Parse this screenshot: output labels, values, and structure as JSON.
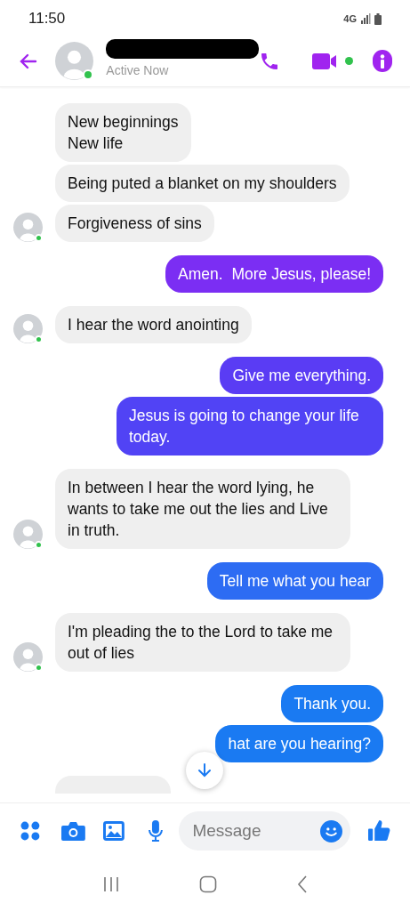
{
  "status_bar": {
    "time": "11:50",
    "network": "4G"
  },
  "header": {
    "status": "Active Now",
    "online": true
  },
  "messages": [
    {
      "kind": "incoming",
      "text": "New beginnings\nNew life"
    },
    {
      "kind": "incoming",
      "text": "Being puted a blanket on my shoulders"
    },
    {
      "kind": "incoming",
      "text": "Forgiveness of sins"
    },
    {
      "kind": "outgoing",
      "text": "Amen.  More Jesus, please!",
      "color": "#7b2ef3"
    },
    {
      "kind": "incoming",
      "text": "I hear the word anointing"
    },
    {
      "kind": "outgoing",
      "text": "Give me everything.",
      "color": "#5a3cf4"
    },
    {
      "kind": "outgoing",
      "text": "Jesus is going to change your life today.",
      "color": "#5143f5"
    },
    {
      "kind": "incoming",
      "text": "In between I hear the word lying, he wants to take me out the lies and Live in truth."
    },
    {
      "kind": "outgoing",
      "text": "Tell me what you hear",
      "color": "#2d6cf3"
    },
    {
      "kind": "incoming",
      "text": "I'm pleading the to the Lord to take me out of lies"
    },
    {
      "kind": "outgoing",
      "text": "Thank you.",
      "color": "#1a7af2"
    },
    {
      "kind": "outgoing",
      "text": "hat are you hearing?",
      "color": "#1a7af2"
    },
    {
      "kind": "incoming_cut"
    }
  ],
  "composer": {
    "placeholder": "Message"
  }
}
